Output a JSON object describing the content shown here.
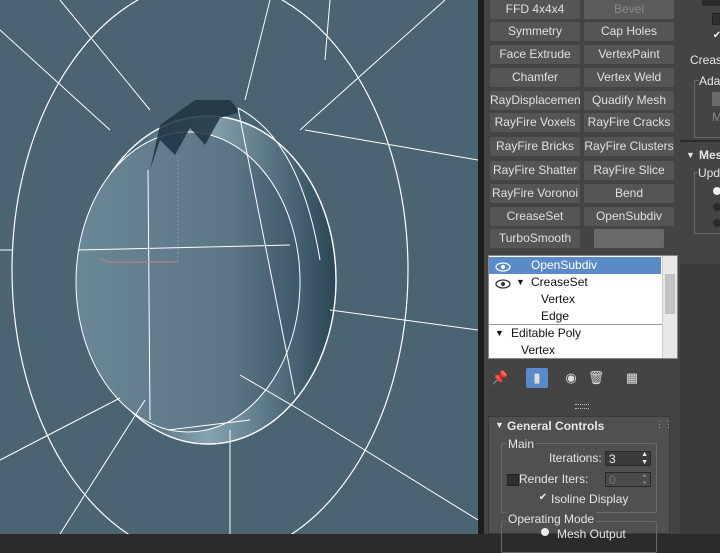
{
  "modifier_buttons": [
    {
      "label": "FFD 4x4x4"
    },
    {
      "label": "Bevel",
      "dim": true
    },
    {
      "label": "Symmetry"
    },
    {
      "label": "Cap Holes"
    },
    {
      "label": "Face Extrude"
    },
    {
      "label": "VertexPaint"
    },
    {
      "label": "Chamfer"
    },
    {
      "label": "Vertex Weld"
    },
    {
      "label": "RayDisplacementMod"
    },
    {
      "label": "Quadify Mesh"
    },
    {
      "label": "RayFire Voxels"
    },
    {
      "label": "RayFire Cracks"
    },
    {
      "label": "RayFire Bricks"
    },
    {
      "label": "RayFire Clusters"
    },
    {
      "label": "RayFire Shatter"
    },
    {
      "label": "RayFire Slice"
    },
    {
      "label": "RayFire Voronoi"
    },
    {
      "label": "Bend"
    },
    {
      "label": "CreaseSet"
    },
    {
      "label": "OpenSubdiv"
    },
    {
      "label": "TurboSmooth"
    },
    {
      "label": "",
      "blank": true
    }
  ],
  "stack": {
    "items": [
      {
        "label": "OpenSubdiv",
        "selected": true,
        "eye": true,
        "indent": 0
      },
      {
        "label": "CreaseSet",
        "eye": true,
        "expanded": true,
        "indent": 0
      },
      {
        "label": "Vertex",
        "indent": 2
      },
      {
        "label": "Edge",
        "indent": 2
      },
      {
        "label": "Editable Poly",
        "expanded": true,
        "indent": 0
      },
      {
        "label": "Vertex",
        "indent": 1
      }
    ]
  },
  "stack_tools": [
    "pin-icon",
    "show-end-result-icon",
    "make-unique-icon",
    "remove-modifier-icon",
    "configure-modifier-sets-icon"
  ],
  "general_controls": {
    "title": "General Controls",
    "main_group": "Main",
    "iterations_label": "Iterations:",
    "iterations_value": "3",
    "render_iters_label": "Render Iters:",
    "render_iters_value": "0",
    "isoline_label": "Isoline Display",
    "isoline_checked": true,
    "operating_mode_group": "Operating Mode",
    "mesh_output_label": "Mesh Output"
  },
  "right_panel": {
    "crease_label": "Creas",
    "ada_label": "Ada",
    "m_label": "M",
    "mes_title": "Mes",
    "upd_label": "Upd"
  },
  "colors": {
    "viewport_bg": "#4b6472",
    "selection": "#5b8ac9",
    "panel_bg": "#444444"
  }
}
